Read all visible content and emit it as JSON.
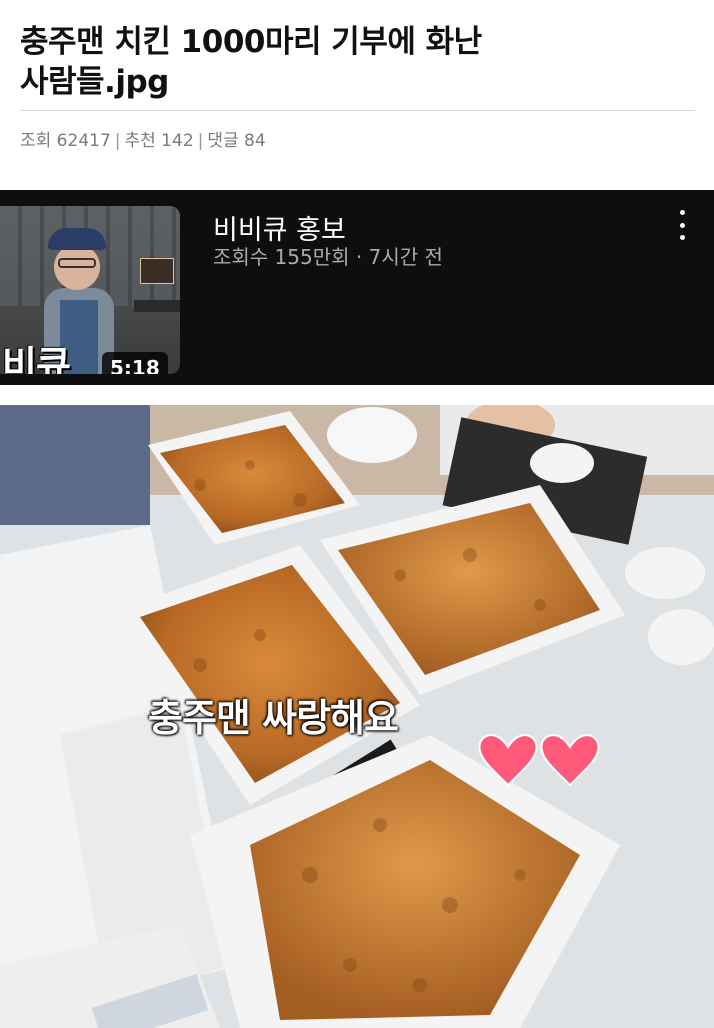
{
  "post": {
    "title_line1": "충주맨 치킨 1000마리 기부에 화난",
    "title_line2": "사람들.jpg",
    "views": "조회 62417",
    "recommends": "추천 142",
    "comments": "댓글 84",
    "separator": "|"
  },
  "video": {
    "title": "비비큐 홍보",
    "meta": "조회수 155만회 · 7시간 전",
    "duration": "5:18",
    "thumbnail_text": "비큐",
    "more_icon": "more-vertical-icon"
  },
  "photo": {
    "caption": "충주맨 싸랑해요",
    "hearts_icon": "heart-icon"
  },
  "colors": {
    "video_bg": "#0e0e0e",
    "heart": "#ff5a7a",
    "chicken": "#c8772e"
  }
}
